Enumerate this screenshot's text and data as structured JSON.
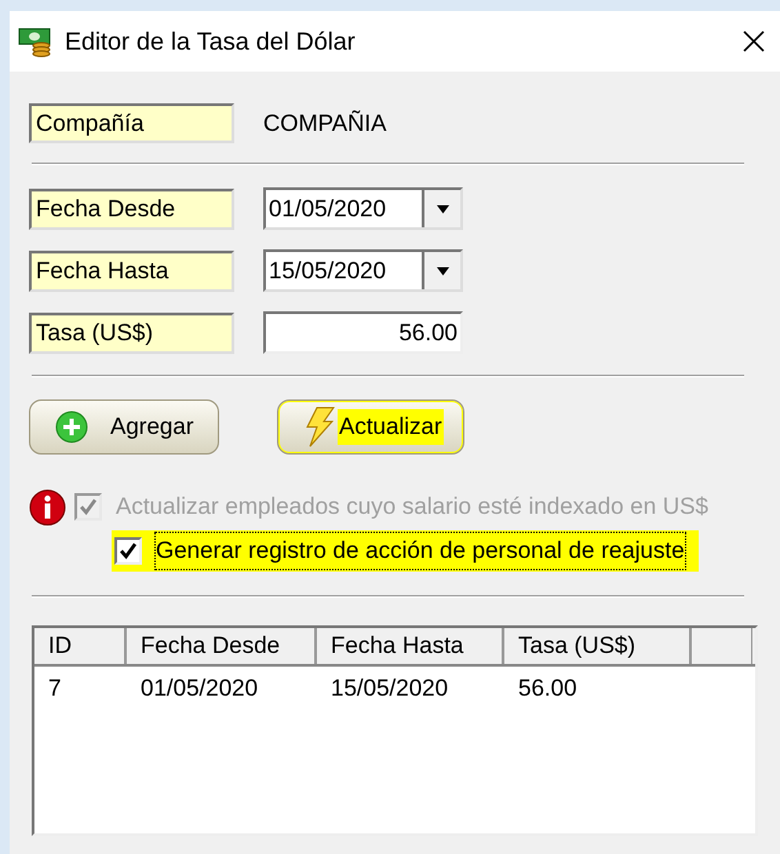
{
  "window": {
    "title": "Editor de la Tasa del Dólar"
  },
  "company": {
    "label": "Compañía",
    "value": "COMPAÑIA"
  },
  "fields": [
    {
      "kind": "date",
      "label": "Fecha Desde",
      "value": "01/05/2020"
    },
    {
      "kind": "date",
      "label": "Fecha Hasta",
      "value": "15/05/2020"
    },
    {
      "kind": "number",
      "label": "Tasa (US$)",
      "value": "56.00"
    }
  ],
  "buttons": [
    {
      "kind": "add",
      "label": "Agregar",
      "highlighted": false
    },
    {
      "kind": "update",
      "label": "Actualizar",
      "highlighted": true
    }
  ],
  "options": [
    {
      "label": "Actualizar empleados cuyo salario esté indexado en US$",
      "checked": true,
      "disabled": true,
      "info": true,
      "highlighted": false
    },
    {
      "label": "Generar registro de acción de personal de reajuste",
      "checked": true,
      "disabled": false,
      "info": false,
      "highlighted": true
    }
  ],
  "table": {
    "columns": [
      "ID",
      "Fecha Desde",
      "Fecha Hasta",
      "Tasa (US$)"
    ],
    "rows": [
      [
        "7",
        "01/05/2020",
        "15/05/2020",
        "56.00"
      ]
    ]
  }
}
